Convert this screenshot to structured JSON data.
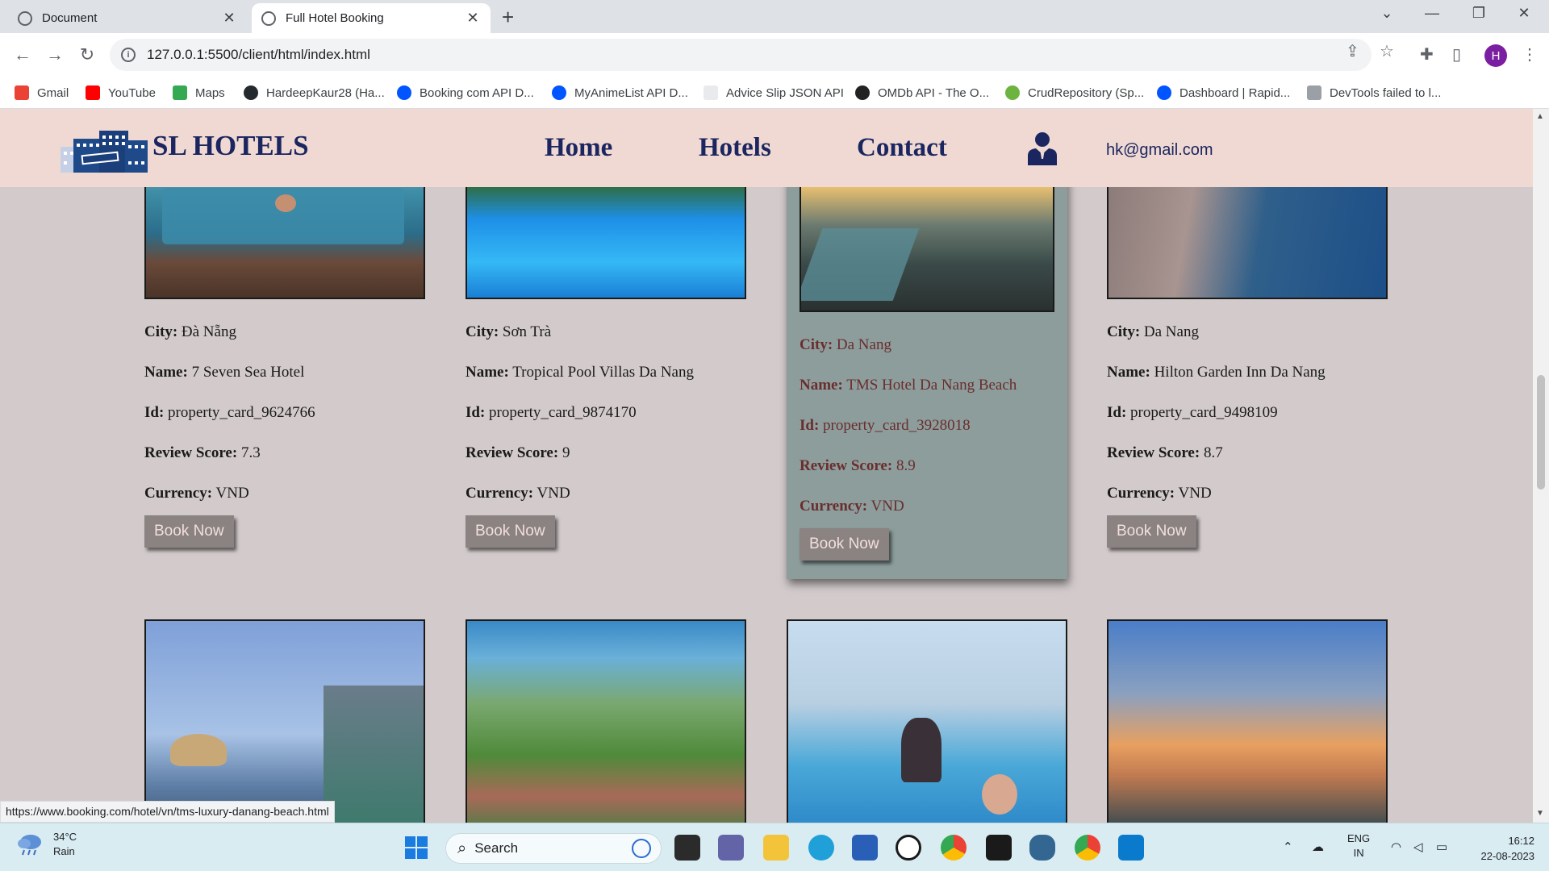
{
  "browser": {
    "tabs": [
      {
        "title": "Document",
        "active": false
      },
      {
        "title": "Full Hotel Booking",
        "active": true
      }
    ],
    "url": "127.0.0.1:5500/client/html/index.html",
    "profile_initial": "H",
    "bookmarks": [
      {
        "label": "Gmail",
        "icon": "gmail-icon",
        "color": "#ea4335"
      },
      {
        "label": "YouTube",
        "icon": "youtube-icon",
        "color": "#ff0000"
      },
      {
        "label": "Maps",
        "icon": "maps-icon",
        "color": "#34a853"
      },
      {
        "label": "HardeepKaur28 (Ha...",
        "icon": "github-icon",
        "color": "#24292e"
      },
      {
        "label": "Booking com API D...",
        "icon": "rapidapi-icon",
        "color": "#0055ff"
      },
      {
        "label": "MyAnimeList API D...",
        "icon": "rapidapi-icon",
        "color": "#0055ff"
      },
      {
        "label": "Advice Slip JSON API",
        "icon": "page-icon",
        "color": "#e8eaed"
      },
      {
        "label": "OMDb API - The O...",
        "icon": "omdb-icon",
        "color": "#222222"
      },
      {
        "label": "CrudRepository (Sp...",
        "icon": "spring-icon",
        "color": "#6db33f"
      },
      {
        "label": "Dashboard | Rapid...",
        "icon": "rapidapi-icon",
        "color": "#0055ff"
      },
      {
        "label": "DevTools failed to l...",
        "icon": "devtools-icon",
        "color": "#9aa0a6"
      }
    ],
    "status_url": "https://www.booking.com/hotel/vn/tms-luxury-danang-beach.html"
  },
  "site": {
    "brand": "SL HOTELS",
    "nav": {
      "home": "Home",
      "hotels": "Hotels",
      "contact": "Contact"
    },
    "user_email": "hk@gmail.com",
    "colors": {
      "header_bg": "#f0d9d2",
      "navy": "#1b2660",
      "page_bg": "#d3cbcb",
      "hover_card": "#8c9d9c",
      "button": "#8a8382"
    }
  },
  "labels": {
    "city": "City:",
    "name": "Name:",
    "id": "Id:",
    "review": "Review Score:",
    "currency": "Currency:",
    "book": "Book Now"
  },
  "hotels": [
    {
      "city": "Đà Nẵng",
      "name": "7 Seven Sea Hotel",
      "id": "property_card_9624766",
      "review": "7.3",
      "currency": "VND"
    },
    {
      "city": "Sơn Trà",
      "name": "Tropical Pool Villas Da Nang",
      "id": "property_card_9874170",
      "review": "9",
      "currency": "VND"
    },
    {
      "city": "Da Nang",
      "name": "TMS Hotel Da Nang Beach",
      "id": "property_card_3928018",
      "review": "8.9",
      "currency": "VND"
    },
    {
      "city": "Da Nang",
      "name": "Hilton Garden Inn Da Nang",
      "id": "property_card_9498109",
      "review": "8.7",
      "currency": "VND"
    }
  ],
  "taskbar": {
    "weather_temp": "34°C",
    "weather_desc": "Rain",
    "search_placeholder": "Search",
    "lang_top": "ENG",
    "lang_bottom": "IN",
    "time": "16:12",
    "date": "22-08-2023"
  }
}
